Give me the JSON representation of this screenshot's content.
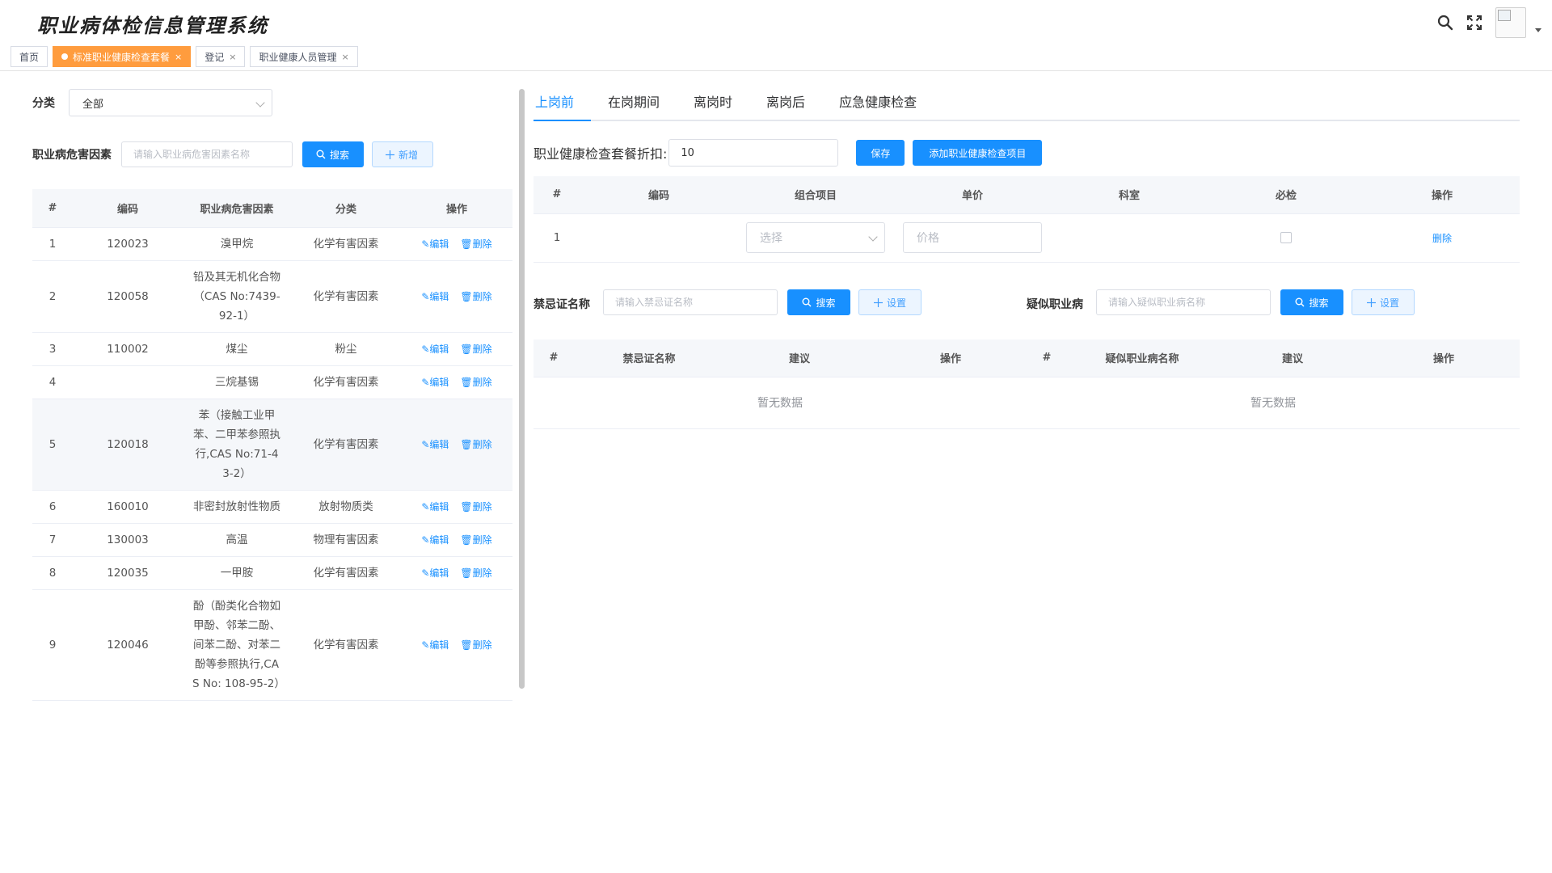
{
  "app": {
    "title": "职业病体检信息管理系统"
  },
  "header": {
    "icons": [
      "search-icon",
      "fullscreen-icon",
      "avatar",
      "caret-down-icon"
    ]
  },
  "tabs": [
    {
      "label": "首页",
      "active": false,
      "closable": false
    },
    {
      "label": "标准职业健康检查套餐",
      "active": true,
      "closable": true
    },
    {
      "label": "登记",
      "active": false,
      "closable": true
    },
    {
      "label": "职业健康人员管理",
      "active": false,
      "closable": true
    }
  ],
  "tab_close_glyph": "×",
  "left": {
    "category_label": "分类",
    "category_value": "全部",
    "factor_label": "职业病危害因素",
    "factor_placeholder": "请输入职业病危害因素名称",
    "search_label": "搜索",
    "add_label": "新增",
    "columns": [
      "#",
      "编码",
      "职业病危害因素",
      "分类",
      "操作"
    ],
    "edit_label": "编辑",
    "delete_label": "删除",
    "rows": [
      {
        "idx": "1",
        "code": "120023",
        "name": "溴甲烷",
        "category": "化学有害因素"
      },
      {
        "idx": "2",
        "code": "120058",
        "name": "铅及其无机化合物（CAS No:7439-92-1）",
        "category": "化学有害因素"
      },
      {
        "idx": "3",
        "code": "110002",
        "name": "煤尘",
        "category": "粉尘"
      },
      {
        "idx": "4",
        "code": "",
        "name": "三烷基锡",
        "category": "化学有害因素"
      },
      {
        "idx": "5",
        "code": "120018",
        "name": "苯（接触工业甲苯、二甲苯参照执行,CAS No:71-43-2）",
        "category": "化学有害因素"
      },
      {
        "idx": "6",
        "code": "160010",
        "name": "非密封放射性物质",
        "category": "放射物质类"
      },
      {
        "idx": "7",
        "code": "130003",
        "name": "高温",
        "category": "物理有害因素"
      },
      {
        "idx": "8",
        "code": "120035",
        "name": "一甲胺",
        "category": "化学有害因素"
      },
      {
        "idx": "9",
        "code": "120046",
        "name": "酚（酚类化合物如甲酚、邻苯二酚、间苯二酚、对苯二酚等参照执行,CAS No: 108-95-2）",
        "category": "化学有害因素"
      }
    ]
  },
  "right": {
    "tabs": [
      "上岗前",
      "在岗期间",
      "离岗时",
      "离岗后",
      "应急健康检查"
    ],
    "active_tab": 0,
    "discount_label": "职业健康检查套餐折扣:",
    "discount_value": "10",
    "save_label": "保存",
    "add_item_label": "添加职业健康检查项目",
    "items_columns": [
      "#",
      "编码",
      "组合项目",
      "单价",
      "科室",
      "必检",
      "操作"
    ],
    "items_rows": [
      {
        "idx": "1",
        "code": "",
        "combo_placeholder": "选择",
        "price_placeholder": "价格",
        "dept": "",
        "required": false,
        "action": "删除"
      }
    ],
    "contra_label": "禁忌证名称",
    "contra_placeholder": "请输入禁忌证名称",
    "contra_search_label": "搜索",
    "contra_set_label": "设置",
    "suspect_label": "疑似职业病",
    "suspect_placeholder": "请输入疑似职业病名称",
    "suspect_search_label": "搜索",
    "suspect_set_label": "设置",
    "contra_columns": [
      "#",
      "禁忌证名称",
      "建议",
      "操作"
    ],
    "suspect_columns": [
      "#",
      "疑似职业病名称",
      "建议",
      "操作"
    ],
    "empty_text": "暂无数据"
  },
  "colors": {
    "primary": "#1890ff",
    "active_tab": "#ff9c3e",
    "border": "#dcdfe6",
    "header_bg": "#f5f7fa"
  }
}
